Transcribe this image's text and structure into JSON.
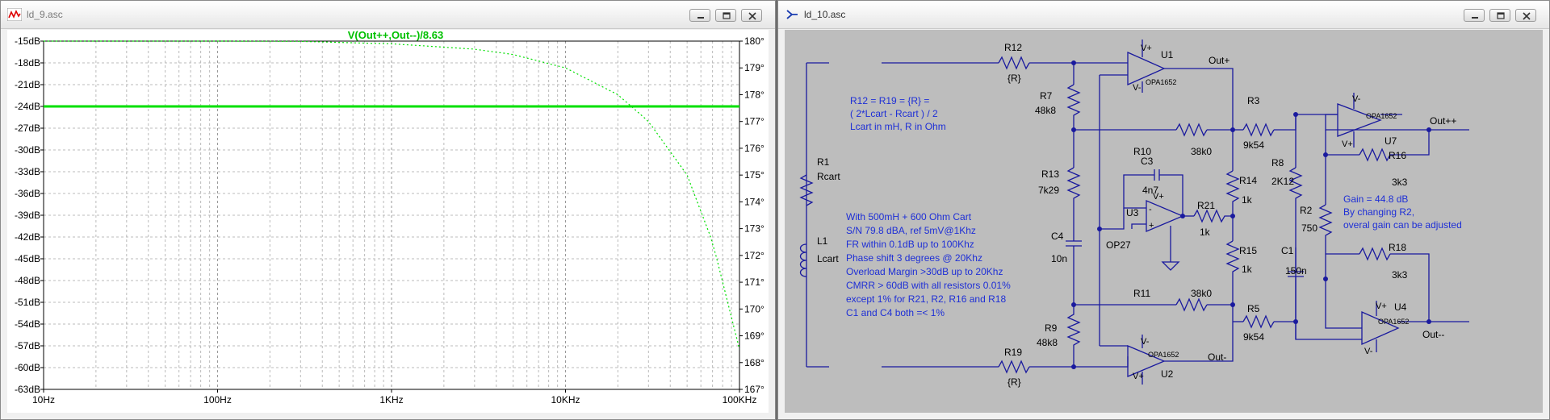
{
  "plot_window": {
    "title": "ld_9.asc"
  },
  "schematic_window": {
    "title": "ld_10.asc"
  },
  "chart_data": {
    "type": "line",
    "trace_label": "V(Out++,Out--)/8.63",
    "trace_color": "#00e000",
    "x_axis": {
      "scale": "log",
      "range": [
        10,
        100000
      ],
      "tick_labels": [
        "10Hz",
        "100Hz",
        "1KHz",
        "10KHz",
        "100KHz"
      ]
    },
    "y_left": {
      "range": [
        -63,
        -15
      ],
      "tick_values": [
        -15,
        -18,
        -21,
        -24,
        -27,
        -30,
        -33,
        -36,
        -39,
        -42,
        -45,
        -48,
        -51,
        -54,
        -57,
        -60,
        -63
      ],
      "tick_labels": [
        "-15dB",
        "-18dB",
        "-21dB",
        "-24dB",
        "-27dB",
        "-30dB",
        "-33dB",
        "-36dB",
        "-39dB",
        "-42dB",
        "-45dB",
        "-48dB",
        "-51dB",
        "-54dB",
        "-57dB",
        "-60dB",
        "-63dB"
      ]
    },
    "y_right": {
      "range": [
        167,
        180
      ],
      "tick_values": [
        180,
        179,
        178,
        177,
        176,
        175,
        174,
        173,
        172,
        171,
        170,
        169,
        168,
        167
      ],
      "tick_labels": [
        "180°",
        "179°",
        "178°",
        "177°",
        "176°",
        "175°",
        "174°",
        "173°",
        "172°",
        "171°",
        "170°",
        "169°",
        "168°",
        "167°"
      ]
    },
    "series": [
      {
        "name": "V(Out++,Out--)/8.63",
        "kind": "magnitude",
        "style": "solid",
        "x": [
          10,
          100,
          1000,
          10000,
          100000
        ],
        "y": [
          -24,
          -24,
          -24,
          -24,
          -24
        ]
      },
      {
        "name": "V(Out++,Out--)/8.63",
        "kind": "phase",
        "style": "dotted",
        "x": [
          10,
          100,
          300,
          1000,
          3000,
          5000,
          10000,
          20000,
          30000,
          50000,
          70000,
          100000
        ],
        "y": [
          180,
          180,
          179.99,
          179.9,
          179.7,
          179.5,
          179,
          178,
          177,
          175,
          172.5,
          168.5
        ]
      }
    ]
  },
  "schematic": {
    "components": {
      "r12": {
        "name": "R12",
        "value": "{R}"
      },
      "r19": {
        "name": "R19",
        "value": "{R}"
      },
      "r7": {
        "name": "R7",
        "value": "48k8"
      },
      "r13": {
        "name": "R13",
        "value": "7k29"
      },
      "r9": {
        "name": "R9",
        "value": "48k8"
      },
      "c4": {
        "name": "C4",
        "value": "10n"
      },
      "r1": {
        "name": "R1",
        "value": "Rcart"
      },
      "l1": {
        "name": "L1",
        "value": "Lcart"
      },
      "r10": {
        "name": "R10",
        "value": "38k0"
      },
      "r11": {
        "name": "R11",
        "value": "38k0"
      },
      "c3": {
        "name": "C3",
        "value": "4n7"
      },
      "u3": {
        "name": "U3",
        "value": "OP27"
      },
      "r21": {
        "name": "R21",
        "value": "1k"
      },
      "r14": {
        "name": "R14",
        "value": "1k"
      },
      "r15": {
        "name": "R15",
        "value": "1k"
      },
      "r3": {
        "name": "R3",
        "value": "9k54"
      },
      "r5": {
        "name": "R5",
        "value": "9k54"
      },
      "r8": {
        "name": "R8",
        "value": "2K12"
      },
      "c1": {
        "name": "C1",
        "value": "150n"
      },
      "r2": {
        "name": "R2",
        "value": "750"
      },
      "r16": {
        "name": "R16",
        "value": "3k3"
      },
      "r18": {
        "name": "R18",
        "value": "3k3"
      },
      "u1": {
        "name": "U1",
        "value": "OPA1652"
      },
      "u2": {
        "name": "U2",
        "value": "OPA1652"
      },
      "u7": {
        "name": "U7",
        "value": "OPA1652"
      },
      "u4": {
        "name": "U4",
        "value": "OPA1652"
      }
    },
    "nets": {
      "out_p": "Out+",
      "out_m": "Out-",
      "out_pp": "Out++",
      "out_mm": "Out--"
    },
    "pins": {
      "vplus": "V+",
      "vminus": "V-",
      "plus": "+",
      "minus": "-"
    },
    "notes": {
      "formula": [
        "R12 = R19 = {R} =",
        "( 2*Lcart - Rcart ) / 2",
        "Lcart in mH, R in Ohm"
      ],
      "specs": [
        "With 500mH + 600 Ohm Cart",
        "S/N  79.8 dBA, ref 5mV@1Khz",
        "FR within 0.1dB up to 100Khz",
        "Phase shift 3 degrees @ 20Khz",
        "Overload Margin >30dB up to 20Khz",
        "CMRR > 60dB with all resistors 0.01%",
        "except 1% for R21, R2, R16 and R18",
        "C1 and C4 both =< 1%"
      ],
      "gain": [
        "Gain = 44.8 dB",
        "By changing R2,",
        "overal gain can be adjusted"
      ]
    }
  }
}
